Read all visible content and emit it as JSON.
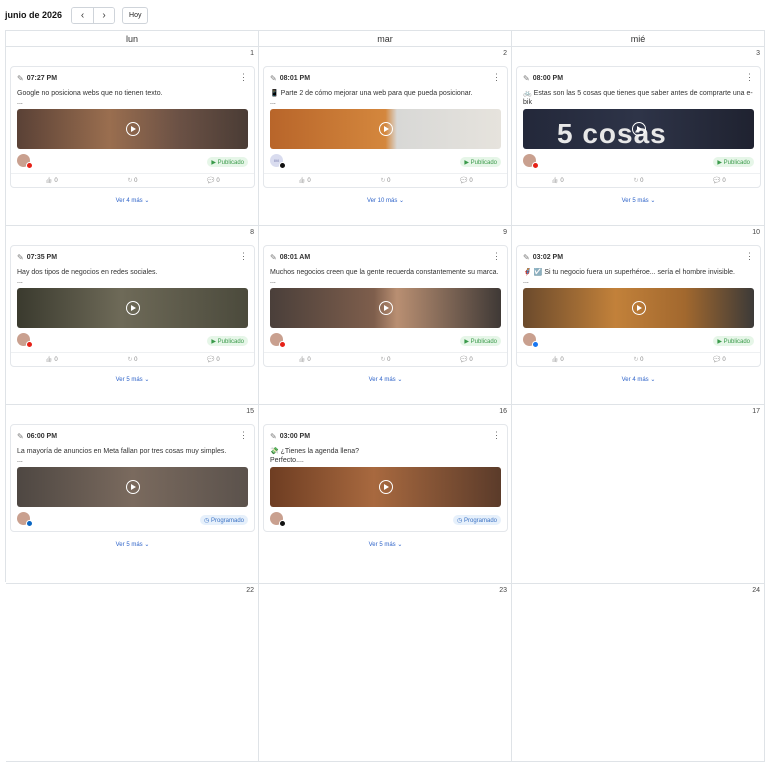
{
  "header": {
    "month": "junio de 2026",
    "prev": "‹",
    "next": "›",
    "today": "Hoy"
  },
  "columns": [
    "lun",
    "mar",
    "mié"
  ],
  "colors": {
    "published": "#3a9a4a",
    "scheduled": "#3b72c4",
    "link": "#2f64c9"
  },
  "weeks": [
    {
      "days": [
        {
          "num": "1",
          "post": {
            "time": "07:27 PM",
            "line1": "Google no posiciona webs que no tienen texto.",
            "line2": "...",
            "status": "▶ Publicado",
            "status_kind": "pub",
            "network": "youtube",
            "stats": [
              "0",
              "0",
              "0"
            ]
          },
          "more": "Ver 4 más ⌄"
        },
        {
          "num": "2",
          "post": {
            "time": "08:01 PM",
            "line1": "📱 Parte 2 de cómo mejorar una web para que pueda posicionar.",
            "line2": "...",
            "status": "▶ Publicado",
            "status_kind": "pub",
            "network": "tiktok",
            "avatar": "IM",
            "stats": [
              "0",
              "0",
              "0"
            ]
          },
          "more": "Ver 10 más ⌄"
        },
        {
          "num": "3",
          "post": {
            "time": "08:00 PM",
            "line1": "🚲 Estas son las 5 cosas que tienes que saber antes de comprarte una e-bik",
            "line2": "e....",
            "status": "▶ Publicado",
            "status_kind": "pub",
            "network": "youtube",
            "thumb_text": "5 cosas",
            "stats": [
              "0",
              "0",
              "0"
            ]
          },
          "more": "Ver 5 más ⌄"
        }
      ]
    },
    {
      "days": [
        {
          "num": "8",
          "post": {
            "time": "07:35 PM",
            "line1": "Hay dos tipos de negocios en redes sociales.",
            "line2": "...",
            "status": "▶ Publicado",
            "status_kind": "pub",
            "network": "youtube",
            "stats": [
              "0",
              "0",
              "0"
            ]
          },
          "more": "Ver 5 más ⌄"
        },
        {
          "num": "9",
          "post": {
            "time": "08:01 AM",
            "line1": "Muchos negocios creen que la gente recuerda constantemente su marca.",
            "line2": "...",
            "status": "▶ Publicado",
            "status_kind": "pub",
            "network": "youtube",
            "stats": [
              "0",
              "0",
              "0"
            ]
          },
          "more": "Ver 4 más ⌄"
        },
        {
          "num": "10",
          "post": {
            "time": "03:02 PM",
            "line1": "🦸 ☑️ Si tu negocio fuera un superhéroe... sería el hombre invisible.",
            "line2": "...",
            "status": "▶ Publicado",
            "status_kind": "pub",
            "network": "facebook",
            "stats": [
              "0",
              "0",
              "0"
            ]
          },
          "more": "Ver 4 más ⌄"
        }
      ]
    },
    {
      "days": [
        {
          "num": "15",
          "post": {
            "time": "06:00 PM",
            "line1": "La mayoría de anuncios en Meta fallan por tres cosas muy simples.",
            "line2": "...",
            "status": "◷ Programado",
            "status_kind": "prog",
            "network": "linkedin",
            "stats": []
          },
          "more": "Ver 5 más ⌄"
        },
        {
          "num": "16",
          "post": {
            "time": "03:00 PM",
            "line1": "💸 ¿Tienes la agenda llena?",
            "line2": "Perfecto....",
            "status": "◷ Programado",
            "status_kind": "prog",
            "network": "threads",
            "stats": []
          },
          "more": "Ver 5 más ⌄"
        },
        {
          "num": "17"
        }
      ]
    },
    {
      "days": [
        {
          "num": "22"
        },
        {
          "num": "23"
        },
        {
          "num": "24"
        }
      ]
    }
  ]
}
